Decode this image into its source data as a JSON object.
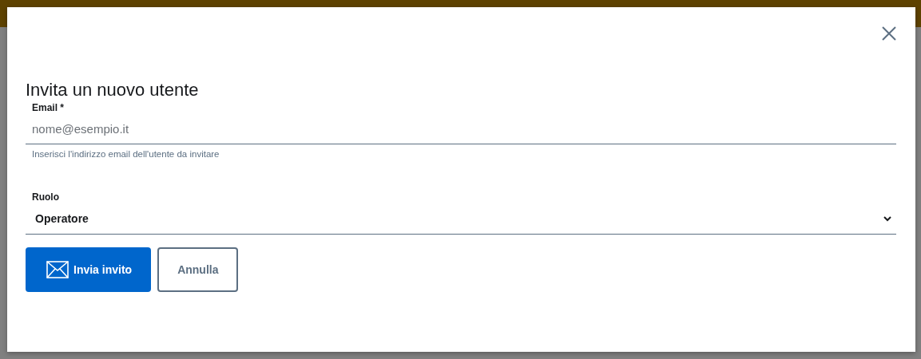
{
  "dialog": {
    "title": "Invita un nuovo utente",
    "email": {
      "label": "Email *",
      "placeholder": "nome@esempio.it",
      "hint": "Inserisci l'indirizzo email dell'utente da invitare"
    },
    "role": {
      "label": "Ruolo",
      "value": "Operatore"
    },
    "buttons": [
      {
        "kind": "primary",
        "label": "Invia invito"
      },
      {
        "kind": "secondary",
        "label": "Annulla"
      }
    ]
  }
}
